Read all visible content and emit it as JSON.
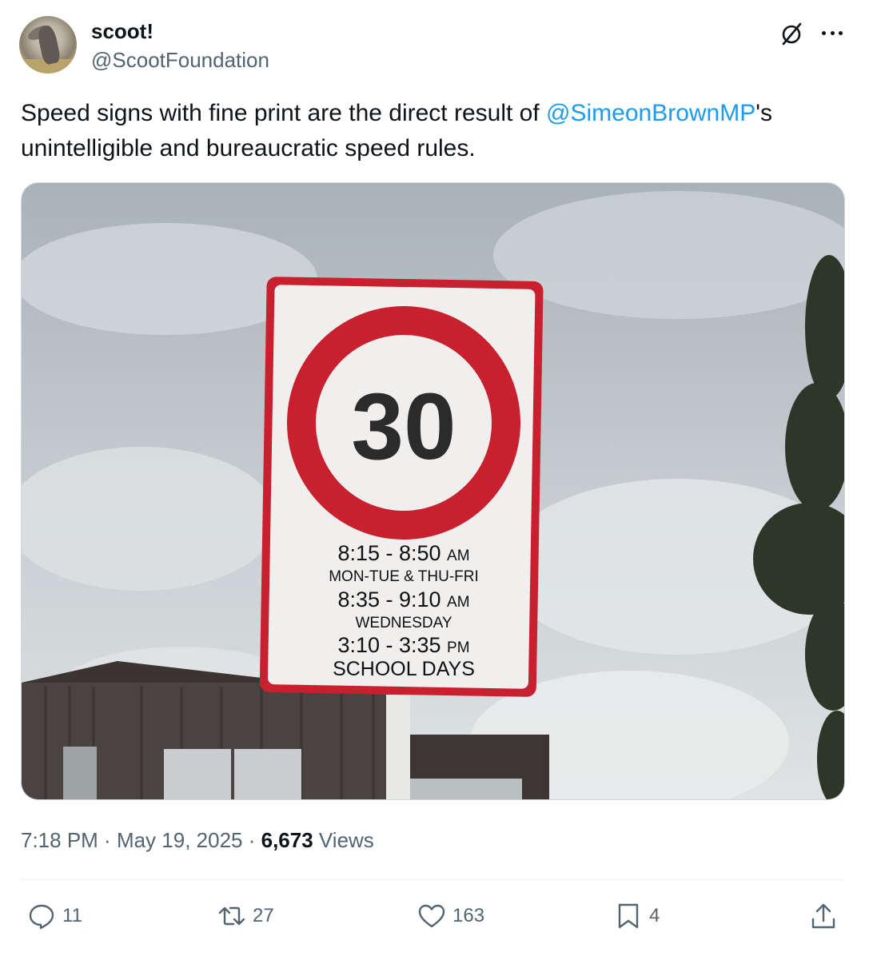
{
  "author": {
    "display_name": "scoot!",
    "handle": "@ScootFoundation"
  },
  "tweet": {
    "text_before": "Speed signs with fine print are the direct result of ",
    "mention": "@SimeonBrownMP",
    "text_after": "'s unintelligible and bureaucratic speed rules."
  },
  "sign": {
    "speed_limit": "30",
    "line1_time": "8:15 - 8:50",
    "line1_ampm": "AM",
    "line2": "MON-TUE & THU-FRI",
    "line3_time": "8:35 - 9:10",
    "line3_ampm": "AM",
    "line4": "WEDNESDAY",
    "line5_time": "3:10 - 3:35",
    "line5_ampm": "PM",
    "line6": "SCHOOL DAYS"
  },
  "meta": {
    "time": "7:18 PM",
    "separator": " · ",
    "date": "May 19, 2025",
    "views_count": "6,673",
    "views_label": "Views"
  },
  "actions": {
    "replies": "11",
    "reposts": "27",
    "likes": "163",
    "bookmarks": "4"
  },
  "colors": {
    "link": "#1d9bf0",
    "secondary_text": "#536471",
    "sign_red": "#c8202f"
  },
  "icons": [
    "grok-icon",
    "more-icon",
    "reply-icon",
    "repost-icon",
    "like-icon",
    "bookmark-icon",
    "share-icon"
  ]
}
